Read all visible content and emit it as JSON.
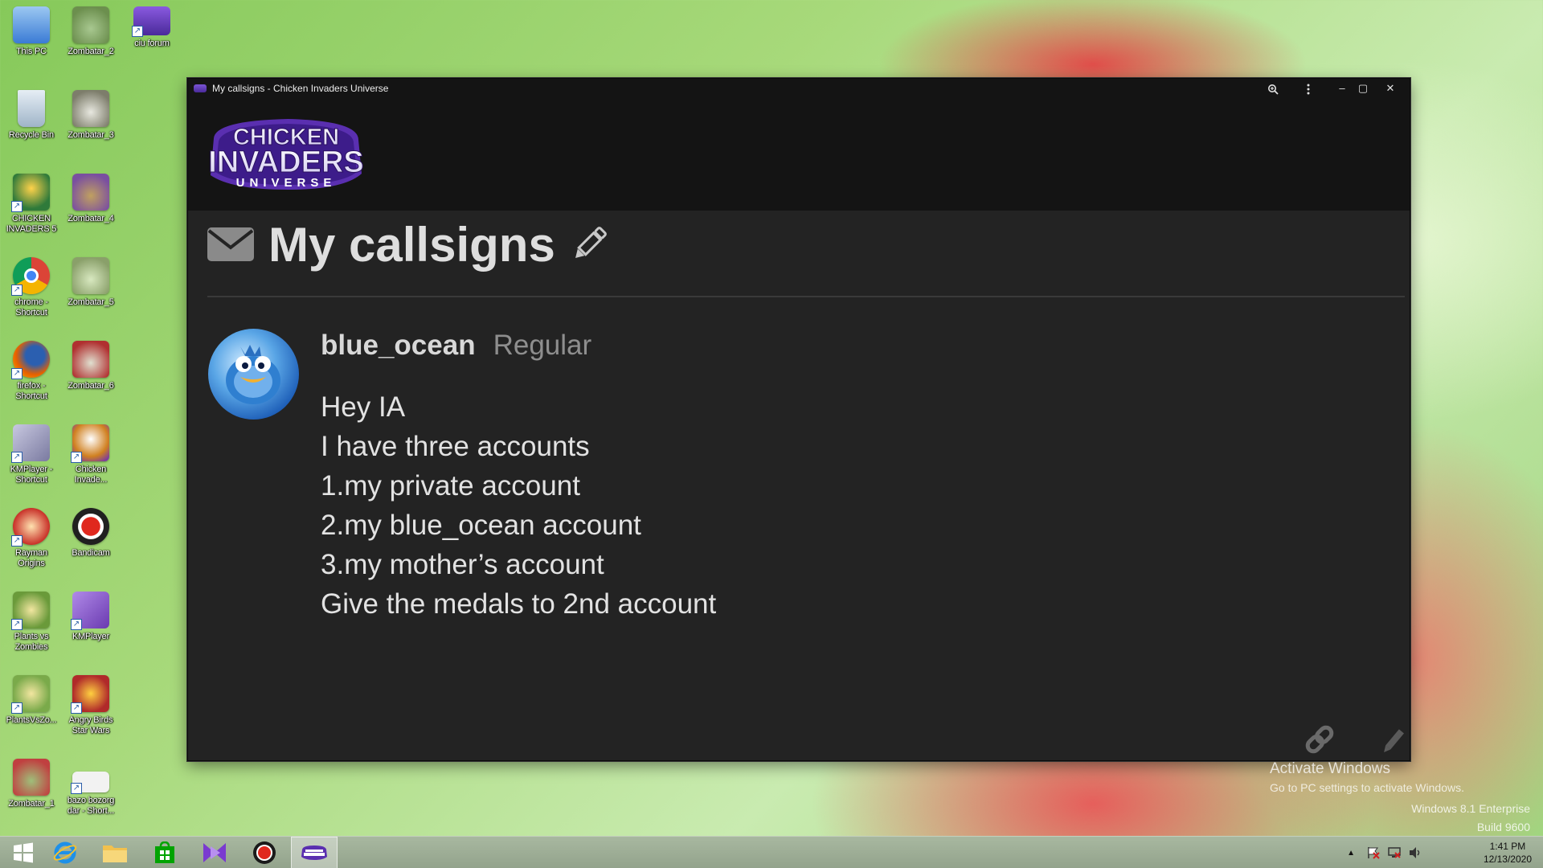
{
  "desktop": {
    "icons": [
      {
        "label": "This PC",
        "color": "#3a7bd5"
      },
      {
        "label": "Zombatar_2",
        "color": "#6c8f4e"
      },
      {
        "label": "ciu forum",
        "color": "#5a3aa0"
      },
      {
        "label": "Recycle Bin",
        "color": "#9fb4c8"
      },
      {
        "label": "Zombatar_3",
        "color": "#7d7d6b"
      },
      {
        "label": "CHICKEN INVADERS 5",
        "color": "#2f7a3a"
      },
      {
        "label": "Zombatar_4",
        "color": "#7a4fa0"
      },
      {
        "label": "chrome - Shortcut",
        "color": "#dd4b39"
      },
      {
        "label": "Zombatar_5",
        "color": "#8aa06a"
      },
      {
        "label": "firefox - Shortcut",
        "color": "#e66000"
      },
      {
        "label": "Zombatar_6",
        "color": "#b03030"
      },
      {
        "label": "KMPlayer - Shortcut",
        "color": "#8a8aa8"
      },
      {
        "label": "Chicken Invade...",
        "color": "#d08020"
      },
      {
        "label": "Rayman Origins",
        "color": "#c83028"
      },
      {
        "label": "Bandicam",
        "color": "#202020"
      },
      {
        "label": "Plants vs Zombies",
        "color": "#6a9a3a"
      },
      {
        "label": "KMPlayer",
        "color": "#6a3ab0"
      },
      {
        "label": "PlantsVsZo...",
        "color": "#7aaa4a"
      },
      {
        "label": "Angry Birds Star Wars",
        "color": "#b02a2a"
      },
      {
        "label": "Zombatar_1",
        "color": "#c04040"
      },
      {
        "label": "bazo bozorg dar - Short...",
        "color": "#f2f2f2"
      }
    ]
  },
  "window": {
    "title": "My callsigns - Chicken Invaders Universe",
    "controls": {
      "zoom_icon": "zoom-icon",
      "menu_icon": "more-vert-icon",
      "minimize": "–",
      "maximize": "▢",
      "close": "✕"
    },
    "logo_text": {
      "line1": "CHICKEN",
      "line2": "INVADERS",
      "line3": "UNIVERSE"
    },
    "page": {
      "title": "My callsigns",
      "username": "blue_ocean",
      "rank": "Regular",
      "message_lines": [
        "Hey IA",
        "I have three accounts",
        "1.my private account",
        "2.my blue_ocean account",
        "3.my mother’s account",
        "Give the medals to 2nd account"
      ]
    }
  },
  "watermark": {
    "title": "Activate Windows",
    "subtitle": "Go to PC settings to activate Windows.",
    "edition": "Windows 8.1 Enterprise",
    "build": "Build 9600"
  },
  "taskbar": {
    "items": [
      {
        "name": "start-button",
        "icon": "windows-logo-icon"
      },
      {
        "name": "internet-explorer-button",
        "icon": "ie-icon"
      },
      {
        "name": "file-explorer-button",
        "icon": "folder-icon"
      },
      {
        "name": "store-button",
        "icon": "store-icon"
      },
      {
        "name": "kmplayer-button",
        "icon": "kmplayer-icon"
      },
      {
        "name": "bandicam-button",
        "icon": "record-icon"
      },
      {
        "name": "ciu-button",
        "icon": "ciu-icon"
      }
    ],
    "clock": {
      "time": "1:41 PM",
      "date": "12/13/2020"
    }
  },
  "colors": {
    "window_bg": "#222222",
    "titlebar_bg": "#141414",
    "logo_purple": "#5a2fb0",
    "text_primary": "#e2e2e2",
    "rank_gray": "#8e8e8e"
  }
}
